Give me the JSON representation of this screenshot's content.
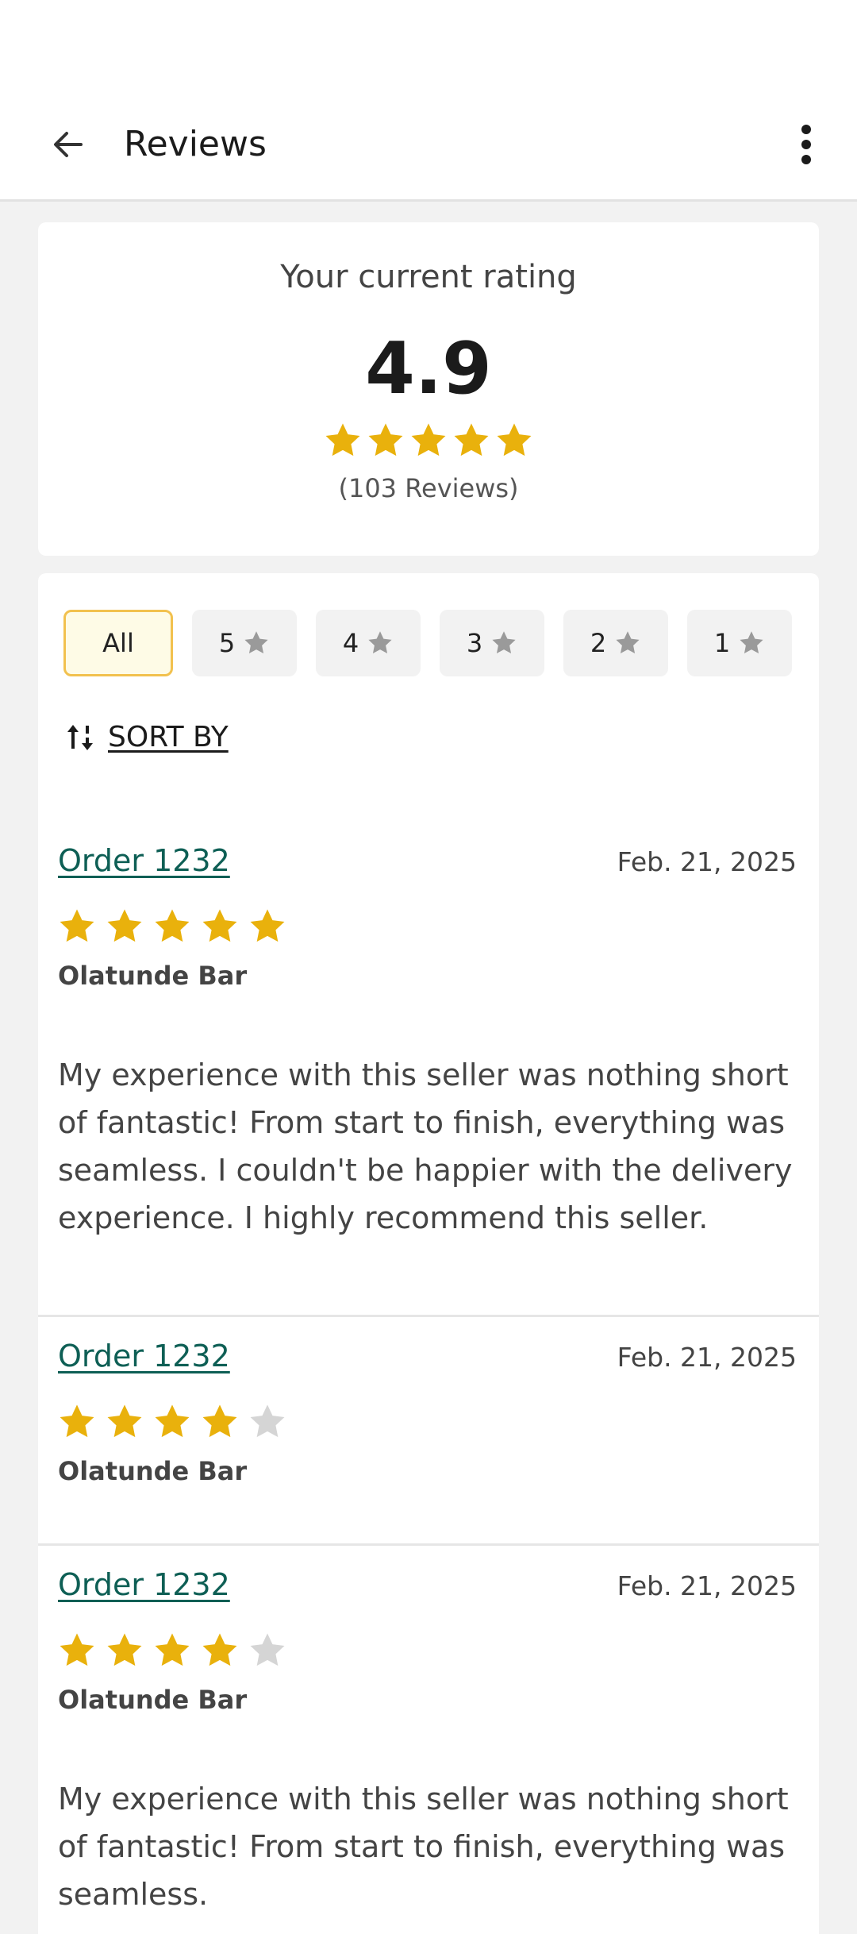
{
  "app_bar": {
    "title": "Reviews"
  },
  "rating": {
    "heading": "Your current rating",
    "value": "4.9",
    "stars_filled": 5,
    "count_text": "(103 Reviews)"
  },
  "filters": [
    {
      "label": "All",
      "active": true,
      "star": false
    },
    {
      "label": "5",
      "active": false,
      "star": true
    },
    {
      "label": "4",
      "active": false,
      "star": true
    },
    {
      "label": "3",
      "active": false,
      "star": true
    },
    {
      "label": "2",
      "active": false,
      "star": true
    },
    {
      "label": "1",
      "active": false,
      "star": true
    }
  ],
  "sort": {
    "label": "SORT BY"
  },
  "reviews": [
    {
      "order": "Order 1232",
      "date": "Feb. 21, 2025",
      "rating": 5,
      "reviewer": "Olatunde Bar",
      "text": "My experience with this seller was nothing short of fantastic! From start to finish, everything was seamless. I couldn't be happier with the delivery experience. I highly recommend this seller."
    },
    {
      "order": "Order 1232",
      "date": "Feb. 21, 2025",
      "rating": 4,
      "reviewer": "Olatunde Bar",
      "text": ""
    },
    {
      "order": "Order 1232",
      "date": "Feb. 21, 2025",
      "rating": 4,
      "reviewer": "Olatunde Bar",
      "text": "My experience with this seller was nothing short of fantastic! From start to finish, everything was seamless."
    }
  ],
  "colors": {
    "star_filled": "#e9b10c",
    "star_empty": "#d5d5d5",
    "star_chip": "#9a9a9a",
    "link": "#0e5f55",
    "chip_active_bg": "#fefbe6",
    "chip_active_border": "#f2c14e"
  },
  "icons": {
    "back": "arrow-left-icon",
    "more": "more-vertical-icon",
    "sort": "sort-icon",
    "star": "star-icon"
  }
}
